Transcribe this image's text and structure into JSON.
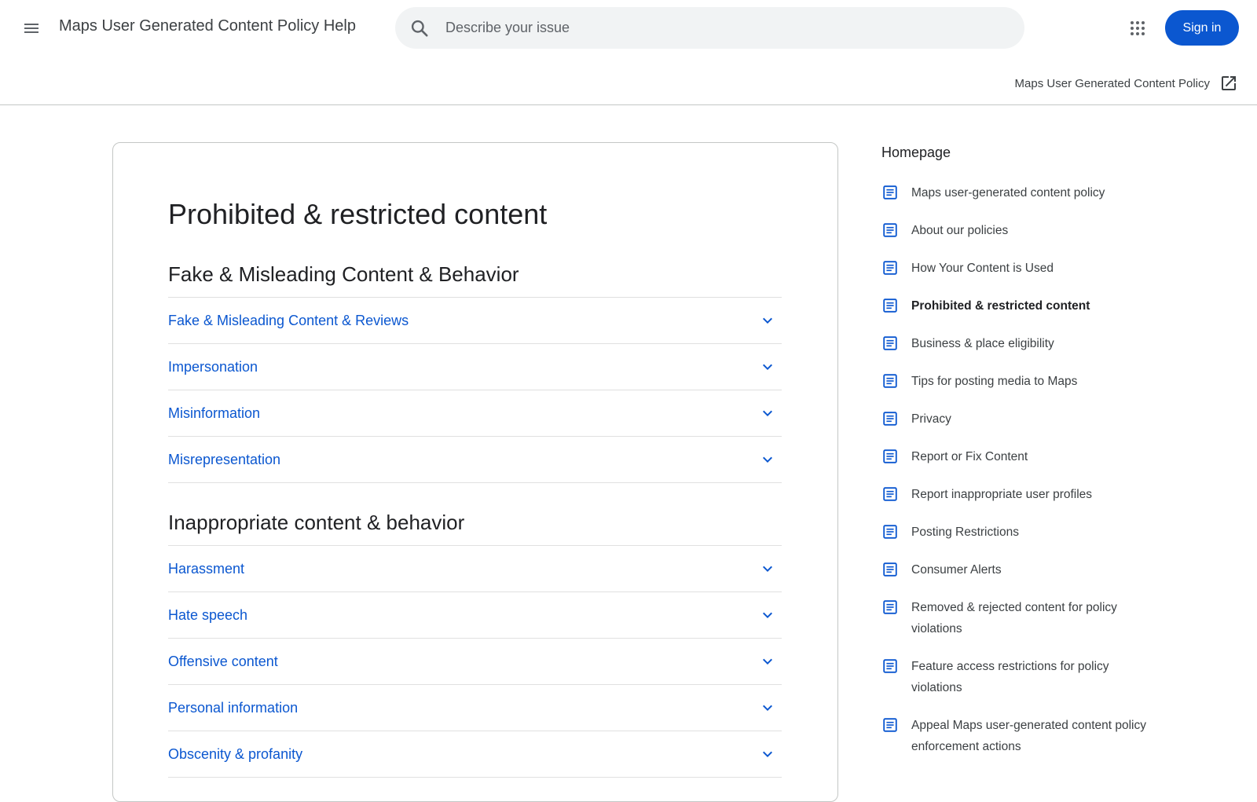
{
  "header": {
    "title": "Maps User Generated Content Policy Help",
    "search_placeholder": "Describe your issue",
    "signin_label": "Sign in"
  },
  "subheader": {
    "external_link_label": "Maps User Generated Content Policy"
  },
  "main": {
    "title": "Prohibited & restricted content",
    "sections": [
      {
        "heading": "Fake & Misleading Content & Behavior",
        "items": [
          "Fake & Misleading Content & Reviews",
          "Impersonation",
          "Misinformation",
          "Misrepresentation"
        ]
      },
      {
        "heading": "Inappropriate content & behavior",
        "items": [
          "Harassment",
          "Hate speech",
          "Offensive content",
          "Personal information",
          "Obscenity & profanity"
        ]
      }
    ]
  },
  "sidebar": {
    "heading": "Homepage",
    "items": [
      "Maps user-generated content policy",
      "About our policies",
      "How Your Content is Used",
      "Prohibited & restricted content",
      "Business & place eligibility",
      "Tips for posting media to Maps",
      "Privacy",
      "Report or Fix Content",
      "Report inappropriate user profiles",
      "Posting Restrictions",
      "Consumer Alerts",
      "Removed & rejected content for policy violations",
      "Feature access restrictions for policy violations",
      "Appeal Maps user-generated content policy enforcement actions"
    ],
    "active_index": 3
  },
  "colors": {
    "accent": "#0b57d0",
    "text": "#202124",
    "muted": "#3c4043",
    "divider": "#e0e0e0",
    "search_bg": "#f1f3f4"
  },
  "icons": {
    "menu": "hamburger-menu-icon",
    "search": "search-icon",
    "apps": "apps-grid-icon",
    "external": "open-in-new-icon",
    "accordion": "chevron-down-icon",
    "sidebar_item": "document-icon"
  }
}
